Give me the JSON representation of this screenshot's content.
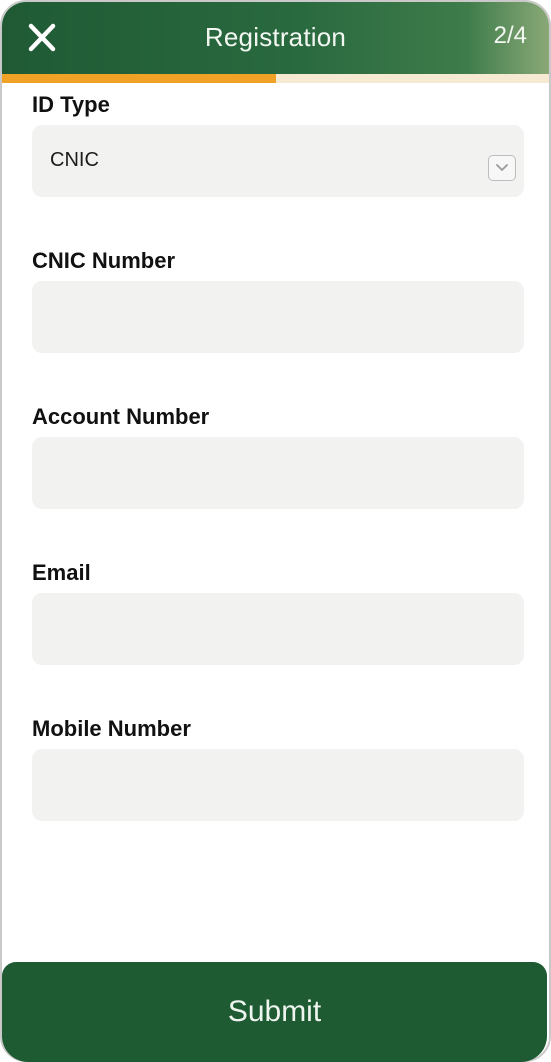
{
  "header": {
    "title": "Registration",
    "step": "2/4",
    "close_icon": "close-icon",
    "progress_fraction": 0.5
  },
  "form": {
    "id_type": {
      "label": "ID Type",
      "value": "CNIC",
      "icon": "chevron-down-icon"
    },
    "cnic_number": {
      "label": "CNIC Number",
      "value": ""
    },
    "account_number": {
      "label": "Account Number",
      "value": ""
    },
    "email": {
      "label": "Email",
      "value": ""
    },
    "mobile_number": {
      "label": "Mobile Number",
      "value": ""
    }
  },
  "footer": {
    "submit_label": "Submit"
  },
  "colors": {
    "header_green": "#1f5a34",
    "progress_orange": "#f0a226",
    "progress_track": "#f6ead2",
    "field_bg": "#f2f2f1",
    "submit_green": "#1e5a32"
  }
}
